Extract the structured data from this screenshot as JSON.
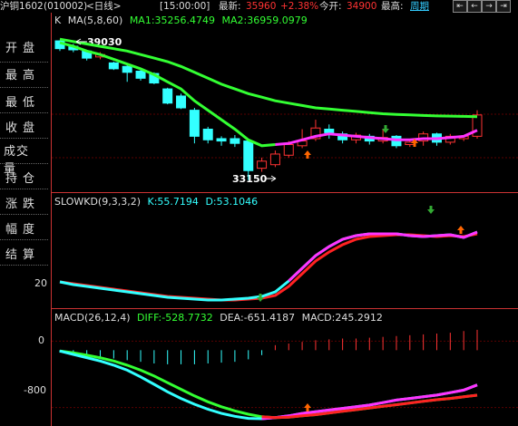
{
  "topbar": {
    "symbol": "沪铜1602",
    "code": "(010002)",
    "period": "<日线>",
    "time": "[15:00:00]",
    "latest_label": "最新:",
    "latest_value": "35960",
    "change": "+2.38%",
    "open_label": "今开:",
    "open_value": "34900",
    "high_label": "最高:",
    "cycle_label": "周期",
    "colors": {
      "up": "#ff3333",
      "label": "#dddddd",
      "accent": "#33ccff"
    }
  },
  "left_panel": {
    "items": [
      "开盘",
      "最高",
      "最低",
      "收盘",
      "成交量",
      "持仓",
      "涨跌",
      "幅度",
      "结算"
    ],
    "axis_kd": "20",
    "axis_macd_top": "0",
    "axis_macd_bottom": "-800"
  },
  "main_chart": {
    "legend_k": "K",
    "ma_label": "MA(5,8,60)",
    "ma1": "MA1:35256.4749",
    "ma2": "MA2:36959.0979",
    "high_annot": "39030",
    "low_annot": "33150"
  },
  "kd_chart": {
    "label": "SLOWKD(9,3,3,2)",
    "k": "K:55.7194",
    "d": "D:53.1046"
  },
  "macd_chart": {
    "label": "MACD(26,12,4)",
    "diff": "DIFF:-528.7732",
    "dea": "DEA:-651.4187",
    "macd": "MACD:245.2912"
  },
  "chart_data": {
    "type": "candlestick",
    "candles": [
      {
        "o": 39030,
        "c": 38700,
        "h": 39030,
        "l": 38600
      },
      {
        "o": 38800,
        "c": 38650,
        "h": 38900,
        "l": 38550
      },
      {
        "o": 38600,
        "c": 38300,
        "h": 38650,
        "l": 38200
      },
      {
        "o": 38350,
        "c": 38450,
        "h": 38550,
        "l": 38250
      },
      {
        "o": 38100,
        "c": 37850,
        "h": 38150,
        "l": 37800
      },
      {
        "o": 37950,
        "c": 37700,
        "h": 38000,
        "l": 37300
      },
      {
        "o": 37750,
        "c": 37450,
        "h": 37800,
        "l": 37350
      },
      {
        "o": 37650,
        "c": 37250,
        "h": 37700,
        "l": 37200
      },
      {
        "o": 37000,
        "c": 36400,
        "h": 37050,
        "l": 36350
      },
      {
        "o": 36700,
        "c": 36200,
        "h": 36800,
        "l": 36150
      },
      {
        "o": 36100,
        "c": 35000,
        "h": 36200,
        "l": 34700
      },
      {
        "o": 35300,
        "c": 34850,
        "h": 35400,
        "l": 34700
      },
      {
        "o": 34900,
        "c": 34800,
        "h": 35000,
        "l": 34600
      },
      {
        "o": 34900,
        "c": 34700,
        "h": 35050,
        "l": 34550
      },
      {
        "o": 34800,
        "c": 33550,
        "h": 34900,
        "l": 33150
      },
      {
        "o": 33650,
        "c": 33950,
        "h": 34100,
        "l": 33500
      },
      {
        "o": 33800,
        "c": 34250,
        "h": 34400,
        "l": 33700
      },
      {
        "o": 34200,
        "c": 34650,
        "h": 34800,
        "l": 34100
      },
      {
        "o": 34600,
        "c": 34800,
        "h": 35300,
        "l": 34500
      },
      {
        "o": 34900,
        "c": 35350,
        "h": 35700,
        "l": 34800
      },
      {
        "o": 35300,
        "c": 35150,
        "h": 35500,
        "l": 34900
      },
      {
        "o": 35100,
        "c": 34850,
        "h": 35200,
        "l": 34700
      },
      {
        "o": 34850,
        "c": 35050,
        "h": 35150,
        "l": 34700
      },
      {
        "o": 35000,
        "c": 34800,
        "h": 35100,
        "l": 34650
      },
      {
        "o": 34800,
        "c": 34950,
        "h": 35300,
        "l": 34700
      },
      {
        "o": 35000,
        "c": 34600,
        "h": 35050,
        "l": 34500
      },
      {
        "o": 34650,
        "c": 34750,
        "h": 34850,
        "l": 34550
      },
      {
        "o": 34800,
        "c": 35100,
        "h": 35200,
        "l": 34600
      },
      {
        "o": 35100,
        "c": 34750,
        "h": 35150,
        "l": 34600
      },
      {
        "o": 34750,
        "c": 35000,
        "h": 35100,
        "l": 34650
      },
      {
        "o": 34900,
        "c": 35000,
        "h": 35050,
        "l": 34800
      },
      {
        "o": 35000,
        "c": 35900,
        "h": 36100,
        "l": 34900
      }
    ],
    "ma_short": [
      38950,
      38800,
      38600,
      38450,
      38250,
      38050,
      37850,
      37600,
      37300,
      37000,
      36500,
      36100,
      35700,
      35300,
      34850,
      34600,
      34650,
      34700,
      34850,
      35000,
      35100,
      35050,
      35000,
      34950,
      34900,
      34850,
      34850,
      34900,
      34900,
      34950,
      35000,
      35250
    ],
    "ma_long": [
      39100,
      39000,
      38900,
      38800,
      38700,
      38600,
      38450,
      38300,
      38150,
      37950,
      37700,
      37450,
      37200,
      37000,
      36800,
      36650,
      36500,
      36400,
      36300,
      36200,
      36150,
      36100,
      36050,
      36000,
      35950,
      35920,
      35900,
      35880,
      35860,
      35850,
      35840,
      35830
    ],
    "price_range": [
      33100,
      39300
    ],
    "kd_k": [
      25,
      22,
      20,
      18,
      16,
      14,
      12,
      10,
      8,
      7,
      6,
      5,
      5,
      6,
      7,
      9,
      14,
      26,
      40,
      54,
      64,
      72,
      76,
      78,
      78,
      78,
      76,
      75,
      76,
      77,
      74,
      80
    ],
    "kd_d": [
      25,
      23,
      21,
      19,
      17,
      15,
      13,
      11,
      9,
      8,
      7,
      6,
      5,
      5,
      6,
      7,
      10,
      20,
      34,
      48,
      58,
      66,
      72,
      75,
      76,
      77,
      77,
      76,
      75,
      76,
      75,
      78
    ],
    "kd_range": [
      0,
      100
    ],
    "macd_diff": [
      -120,
      -160,
      -200,
      -240,
      -290,
      -350,
      -430,
      -520,
      -610,
      -690,
      -760,
      -820,
      -870,
      -905,
      -930,
      -935,
      -920,
      -900,
      -870,
      -850,
      -830,
      -810,
      -790,
      -770,
      -740,
      -710,
      -690,
      -670,
      -650,
      -620,
      -590,
      -528
    ],
    "macd_dea": [
      -120,
      -140,
      -170,
      -200,
      -240,
      -290,
      -350,
      -420,
      -500,
      -580,
      -660,
      -730,
      -790,
      -840,
      -880,
      -910,
      -920,
      -915,
      -900,
      -885,
      -865,
      -845,
      -825,
      -805,
      -785,
      -765,
      -745,
      -725,
      -705,
      -690,
      -670,
      -651
    ],
    "macd_hist": [
      -30,
      -40,
      -60,
      -80,
      -100,
      -120,
      -140,
      -160,
      -170,
      -170,
      -170,
      -160,
      -150,
      -140,
      -110,
      -60,
      60,
      80,
      100,
      120,
      130,
      140,
      140,
      150,
      160,
      170,
      180,
      190,
      200,
      210,
      230,
      245
    ],
    "macd_range": [
      -1000,
      200
    ]
  }
}
